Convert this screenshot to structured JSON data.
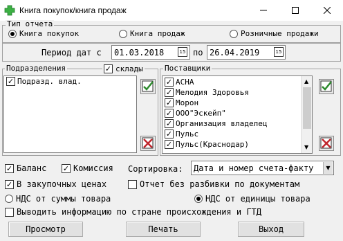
{
  "window": {
    "title": "Книга покупок/книга продаж"
  },
  "report_type": {
    "legend": "Тип отчета",
    "options": [
      {
        "label": "Книга покупок",
        "selected": true
      },
      {
        "label": "Книга продаж",
        "selected": false
      },
      {
        "label": "Розничные продажи",
        "selected": false
      }
    ]
  },
  "period": {
    "prefix": "Период дат с",
    "from": "01.03.2018",
    "to_label": "по",
    "to": "26.04.2019",
    "cal_icon": "15"
  },
  "departments": {
    "legend": "Подразделения",
    "warehouses_label": "склады",
    "warehouses_checked": true,
    "items": [
      {
        "label": "Подразд. влад.",
        "checked": true
      }
    ]
  },
  "suppliers": {
    "legend": "Поставщики",
    "items": [
      {
        "label": "АСНА",
        "checked": true
      },
      {
        "label": "Мелодия Здоровья",
        "checked": true
      },
      {
        "label": "Морон",
        "checked": true
      },
      {
        "label": "ООО\"Эскейп\"",
        "checked": true
      },
      {
        "label": "Организация владелец",
        "checked": true
      },
      {
        "label": "Пульс",
        "checked": true
      },
      {
        "label": "Пульс(Краснодар)",
        "checked": true
      }
    ]
  },
  "options": {
    "balance": {
      "label": "Баланс",
      "checked": true
    },
    "commission": {
      "label": "Комиссия",
      "checked": true
    },
    "sort_label": "Сортировка:",
    "sort_value": "Дата и номер счета-факту",
    "purchase_prices": {
      "label": "В закупочных ценах",
      "checked": true
    },
    "no_breakdown": {
      "label": "Отчет без разбивки по документам",
      "checked": false
    },
    "vat_sum": {
      "label": "НДС от суммы товара",
      "selected": false
    },
    "vat_unit": {
      "label": "НДС от единицы товара",
      "selected": true
    },
    "country_info": {
      "label": "Выводить информацию по стране происхождения и ГТД",
      "checked": false
    }
  },
  "buttons": {
    "preview": "Просмотр",
    "print": "Печать",
    "exit": "Выход"
  },
  "colors": {
    "check_icon": "#2e8b2e",
    "uncheck_icon": "#c0272d",
    "app_cross": "#3cb043"
  }
}
